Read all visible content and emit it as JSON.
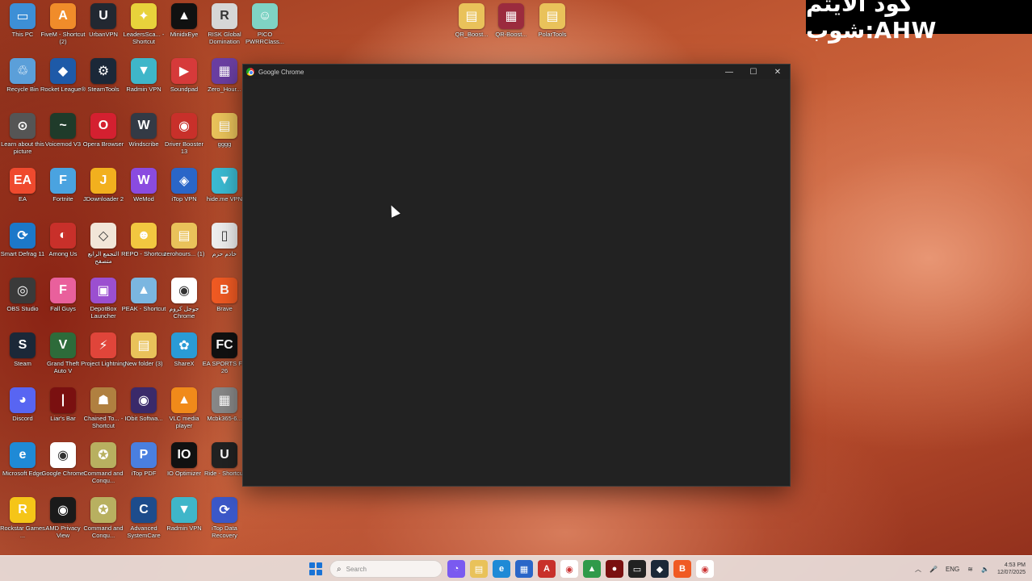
{
  "overlay": {
    "text": "كود الايتم شوب:AHW"
  },
  "window": {
    "title": "Google Chrome",
    "minimize": "—",
    "maximize": "☐",
    "close": "✕"
  },
  "top_icons": [
    {
      "label": "QR_Boost...",
      "color": "#e9c25a",
      "glyph": "▤"
    },
    {
      "label": "QR-Boost...",
      "color": "#9b2b3e",
      "glyph": "▦"
    },
    {
      "label": "PolarTools",
      "color": "#e9c25a",
      "glyph": "▤"
    }
  ],
  "desktop_icons": [
    {
      "label": "This PC",
      "color": "#3d8fd6",
      "glyph": "▭"
    },
    {
      "label": "FiveM - Shortcut (2)",
      "color": "#f08c2a",
      "glyph": "A"
    },
    {
      "label": "UrbanVPN",
      "color": "#222831",
      "glyph": "U"
    },
    {
      "label": "LeadersSca... - Shortcut",
      "color": "#e8d23b",
      "glyph": "✦"
    },
    {
      "label": "MinidxEye",
      "color": "#111111",
      "glyph": "▲"
    },
    {
      "label": "RISK Global Domination",
      "color": "#d6d6d6",
      "glyph": "R"
    },
    {
      "label": "PICO PWRRClass...",
      "color": "#7fd3c4",
      "glyph": "☺"
    },
    {
      "label": "Recycle Bin",
      "color": "#5b9fd9",
      "glyph": "♲"
    },
    {
      "label": "Rocket League®",
      "color": "#1e5aa8",
      "glyph": "◆"
    },
    {
      "label": "SteamTools",
      "color": "#1b2838",
      "glyph": "⚙"
    },
    {
      "label": "Radmin VPN",
      "color": "#3fb6c9",
      "glyph": "▼"
    },
    {
      "label": "Soundpad",
      "color": "#d63a3a",
      "glyph": "▶"
    },
    {
      "label": "Zero_Hour...",
      "color": "#6a3ea1",
      "glyph": "▦"
    },
    {
      "label": "Learn about this picture",
      "color": "#555555",
      "glyph": "⊙"
    },
    {
      "label": "Voicemod V3",
      "color": "#1f3b2a",
      "glyph": "~"
    },
    {
      "label": "Opera Browser",
      "color": "#d42030",
      "glyph": "O"
    },
    {
      "label": "Windscribe",
      "color": "#333a45",
      "glyph": "W"
    },
    {
      "label": "Driver Booster 13",
      "color": "#c8302a",
      "glyph": "◉"
    },
    {
      "label": "gggg",
      "color": "#e9c25a",
      "glyph": "▤"
    },
    {
      "label": "EA",
      "color": "#ef4a2e",
      "glyph": "EA"
    },
    {
      "label": "Fortnite",
      "color": "#4aa3e0",
      "glyph": "F"
    },
    {
      "label": "JDownloader 2",
      "color": "#f2b01e",
      "glyph": "J"
    },
    {
      "label": "WeMod",
      "color": "#8a4be0",
      "glyph": "W"
    },
    {
      "label": "iTop VPN",
      "color": "#2a66c8",
      "glyph": "◈"
    },
    {
      "label": "hide.me VPN",
      "color": "#3bbad2",
      "glyph": "▼"
    },
    {
      "label": "Smart Defrag 11",
      "color": "#1c78c9",
      "glyph": "⟳"
    },
    {
      "label": "Among Us",
      "color": "#c8302a",
      "glyph": "◐"
    },
    {
      "label": "التجمع الرابع متصفح",
      "color": "#f2e6d8",
      "glyph": "◇"
    },
    {
      "label": "REPO - Shortcut",
      "color": "#f2c740",
      "glyph": "☻"
    },
    {
      "label": "zerohours... (1)",
      "color": "#e9c25a",
      "glyph": "▤"
    },
    {
      "label": "خادم حزم",
      "color": "#eeeeee",
      "glyph": "▯"
    },
    {
      "label": "OBS Studio",
      "color": "#3a3a3a",
      "glyph": "◎"
    },
    {
      "label": "Fall Guys",
      "color": "#e9609c",
      "glyph": "F"
    },
    {
      "label": "DepotBox Launcher",
      "color": "#9b4fd0",
      "glyph": "▣"
    },
    {
      "label": "PEAK - Shortcut",
      "color": "#7bb6e0",
      "glyph": "▲"
    },
    {
      "label": "جوجل كروم Chrome",
      "color": "#ffffff",
      "glyph": "◉"
    },
    {
      "label": "Brave",
      "color": "#f05a23",
      "glyph": "B"
    },
    {
      "label": "Steam",
      "color": "#1b2838",
      "glyph": "S"
    },
    {
      "label": "Grand Theft Auto V",
      "color": "#2d6b3a",
      "glyph": "V"
    },
    {
      "label": "Project Lightning",
      "color": "#e0453a",
      "glyph": "⚡"
    },
    {
      "label": "New folder (3)",
      "color": "#e9c25a",
      "glyph": "▤"
    },
    {
      "label": "ShareX",
      "color": "#2a9bd6",
      "glyph": "✿"
    },
    {
      "label": "EA SPORTS FC 26",
      "color": "#111111",
      "glyph": "FC"
    },
    {
      "label": "Discord",
      "color": "#5865f2",
      "glyph": "◕"
    },
    {
      "label": "Liar's Bar",
      "color": "#7a1010",
      "glyph": "|"
    },
    {
      "label": "Chained To... - Shortcut",
      "color": "#b08040",
      "glyph": "☗"
    },
    {
      "label": "IObit Softwa...",
      "color": "#3a2a6a",
      "glyph": "◉"
    },
    {
      "label": "VLC media player",
      "color": "#f08a1a",
      "glyph": "▲"
    },
    {
      "label": "Mcbk365-6...",
      "color": "#888888",
      "glyph": "▦"
    },
    {
      "label": "Microsoft Edge",
      "color": "#1f8ad6",
      "glyph": "e"
    },
    {
      "label": "Google Chrome",
      "color": "#ffffff",
      "glyph": "◉"
    },
    {
      "label": "Command and Conqu...",
      "color": "#b8b060",
      "glyph": "✪"
    },
    {
      "label": "iTop PDF",
      "color": "#4a7fe0",
      "glyph": "P"
    },
    {
      "label": "IO Optimizer",
      "color": "#111111",
      "glyph": "IO"
    },
    {
      "label": "Ride - Shortcut",
      "color": "#222222",
      "glyph": "U"
    },
    {
      "label": "Rockstar Games ...",
      "color": "#f5c518",
      "glyph": "R"
    },
    {
      "label": "AMD Privacy View",
      "color": "#1a1a1a",
      "glyph": "◉"
    },
    {
      "label": "Command and Conqu...",
      "color": "#b8b060",
      "glyph": "✪"
    },
    {
      "label": "Advanced SystemCare",
      "color": "#1d4c8c",
      "glyph": "C"
    },
    {
      "label": "Radmin VPN",
      "color": "#3fb6c9",
      "glyph": "▼"
    },
    {
      "label": "iTop Data Recovery",
      "color": "#3b58c8",
      "glyph": "⟳"
    }
  ],
  "taskbar": {
    "search_placeholder": "Search",
    "apps": [
      {
        "name": "copilot",
        "color": "#7a5af0",
        "glyph": "◔"
      },
      {
        "name": "file-explorer",
        "color": "#e9c25a",
        "glyph": "▤"
      },
      {
        "name": "edge",
        "color": "#1f8ad6",
        "glyph": "e"
      },
      {
        "name": "store",
        "color": "#2a66c8",
        "glyph": "▦"
      },
      {
        "name": "app-red",
        "color": "#c8302a",
        "glyph": "A"
      },
      {
        "name": "chrome",
        "color": "#ffffff",
        "glyph": "◉"
      },
      {
        "name": "app-green",
        "color": "#2f9a4a",
        "glyph": "▲"
      },
      {
        "name": "app-dark-red",
        "color": "#7a1010",
        "glyph": "●"
      },
      {
        "name": "terminal",
        "color": "#222222",
        "glyph": "▭"
      },
      {
        "name": "app-steam",
        "color": "#1b2838",
        "glyph": "◆"
      },
      {
        "name": "brave",
        "color": "#f05a23",
        "glyph": "B"
      },
      {
        "name": "chrome-2",
        "color": "#ffffff",
        "glyph": "◉"
      }
    ],
    "tray": {
      "chevron": "︿",
      "mic": "🎤",
      "lang": "ENG",
      "wifi": "≋",
      "volume": "🔈",
      "time": "4:53 PM",
      "date": "12/07/2025"
    }
  }
}
